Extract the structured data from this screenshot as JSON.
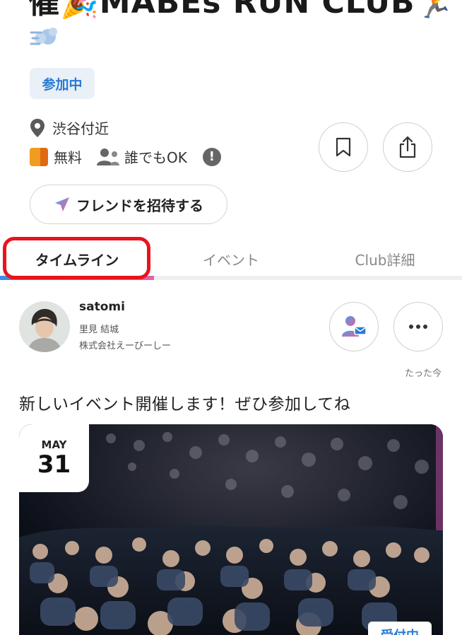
{
  "club": {
    "title": "催🎉MABEs RUN CLUB🏃",
    "title_emoji_icon": "dash-icon",
    "status_badge": "参加中",
    "location": "渋谷付近",
    "fee": "無料",
    "audience": "誰でもOK",
    "invite_label": "フレンドを招待する"
  },
  "tabs": [
    {
      "label": "タイムライン"
    },
    {
      "label": "イベント"
    },
    {
      "label": "Club詳細"
    }
  ],
  "post": {
    "poster_name": "satomi",
    "poster_fullname": "里見 結城",
    "poster_company": "株式会社えーびーしー",
    "timestamp": "たった今",
    "text": "新しいイベント開催します！ぜひ参加してね",
    "event": {
      "month": "MAY",
      "day": "31",
      "status": "受付中"
    }
  },
  "colors": {
    "accent_blue": "#2a7ad3",
    "highlight_red": "#e8131c",
    "tab_gradient_start": "#3a8de0",
    "tab_gradient_end": "#e463a8"
  }
}
